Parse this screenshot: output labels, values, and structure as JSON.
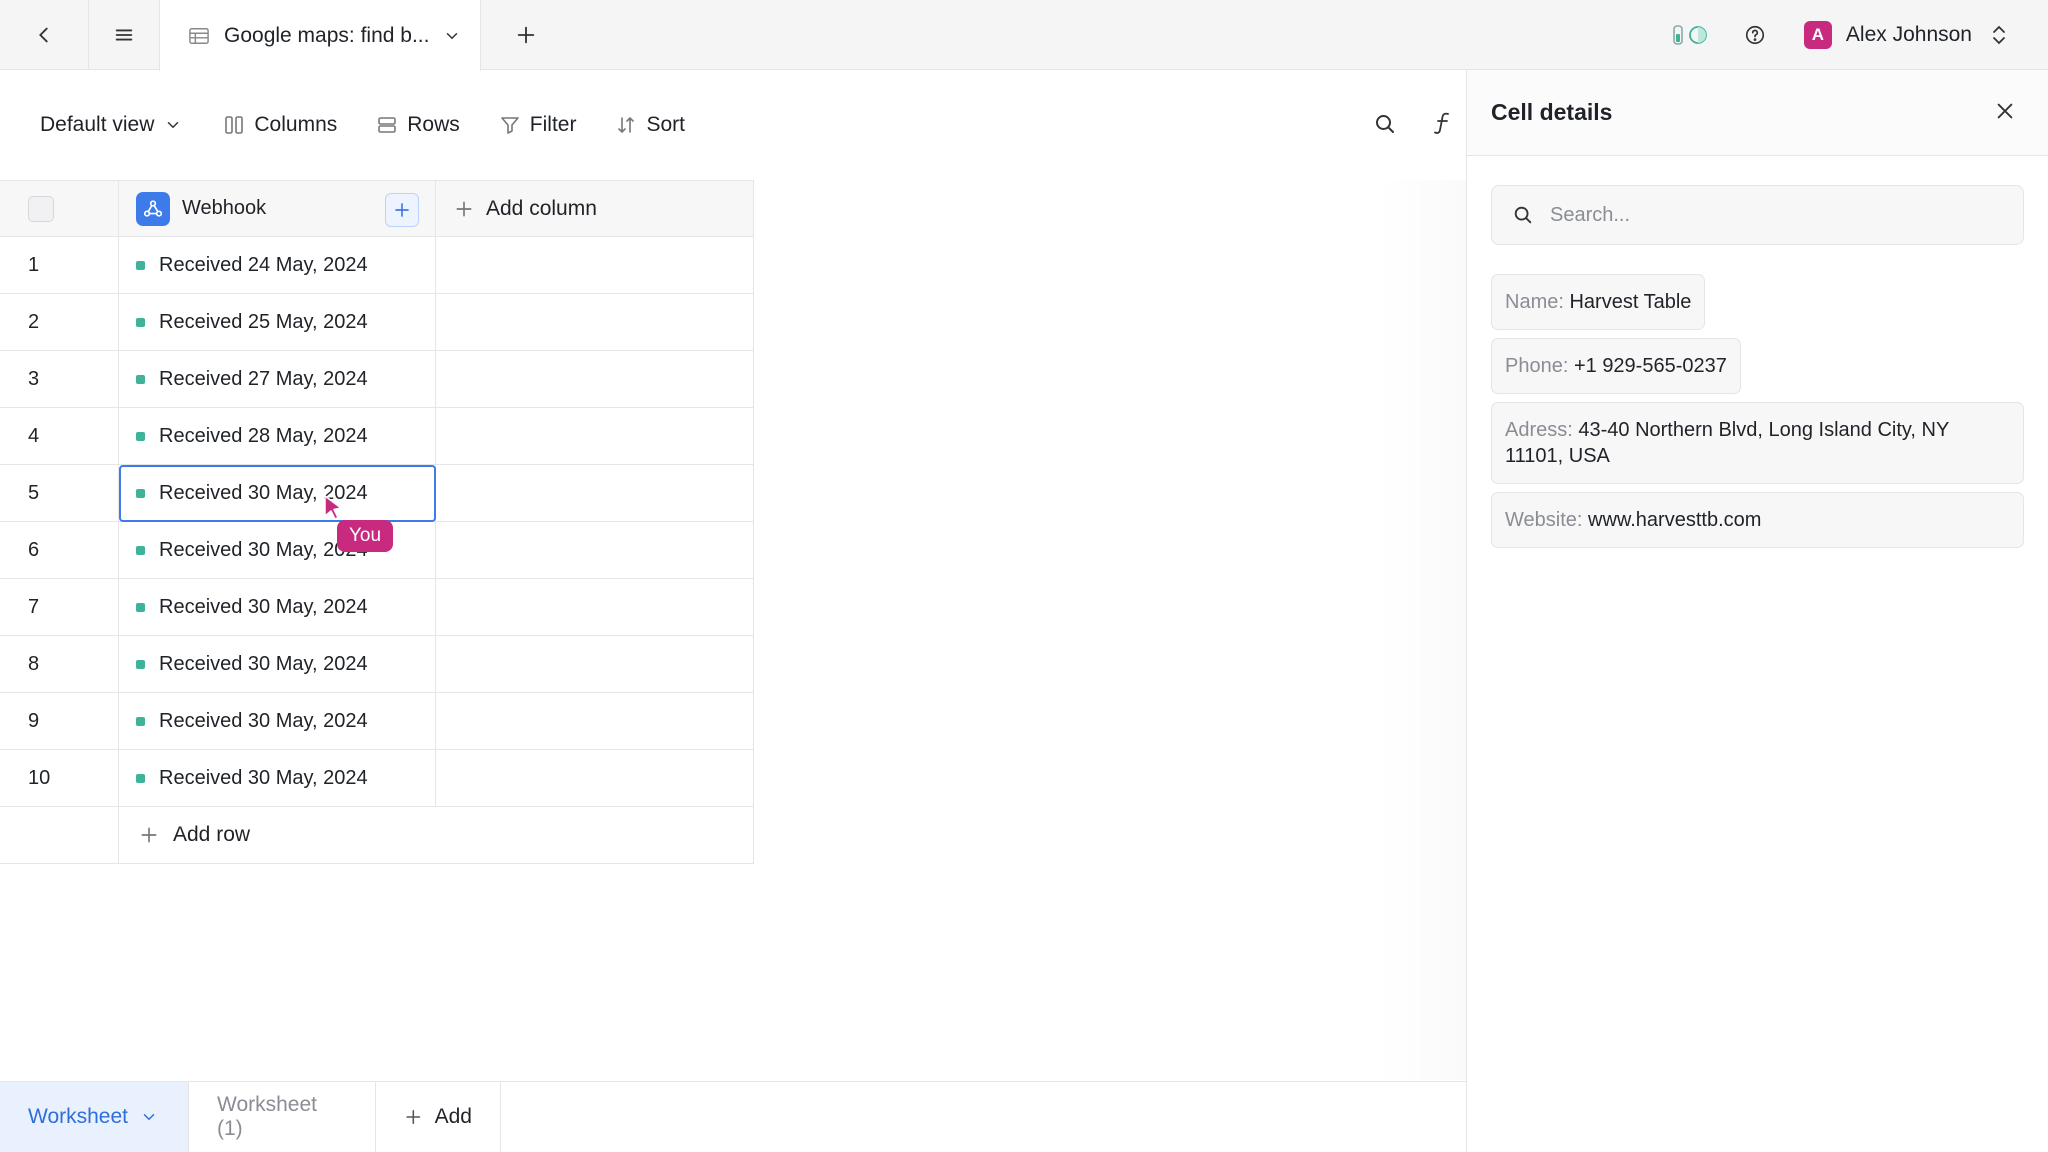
{
  "topbar": {
    "tab_title": "Google maps: find b...",
    "user_name": "Alex Johnson",
    "avatar_letter": "A"
  },
  "toolbar": {
    "view_label": "Default view",
    "columns_label": "Columns",
    "rows_label": "Rows",
    "filter_label": "Filter",
    "sort_label": "Sort"
  },
  "grid": {
    "column_header": "Webhook",
    "add_column_label": "Add column",
    "add_row_label": "Add row",
    "rows": [
      {
        "num": "1",
        "value": "Received 24 May, 2024"
      },
      {
        "num": "2",
        "value": "Received 25 May, 2024"
      },
      {
        "num": "3",
        "value": "Received 27 May, 2024"
      },
      {
        "num": "4",
        "value": "Received 28 May, 2024"
      },
      {
        "num": "5",
        "value": "Received 30 May, 2024"
      },
      {
        "num": "6",
        "value": "Received 30 May, 2024"
      },
      {
        "num": "7",
        "value": "Received 30 May, 2024"
      },
      {
        "num": "8",
        "value": "Received 30 May, 2024"
      },
      {
        "num": "9",
        "value": "Received 30 May, 2024"
      },
      {
        "num": "10",
        "value": "Received 30 May, 2024"
      }
    ],
    "cursor_label": "You"
  },
  "bottombar": {
    "tab_active": "Worksheet",
    "tab_inactive": "Worksheet (1)",
    "add_label": "Add"
  },
  "panel": {
    "title": "Cell details",
    "search_placeholder": "Search...",
    "fields": {
      "name_key": "Name:",
      "name_value": "Harvest Table",
      "phone_key": "Phone:",
      "phone_value": "+1 929-565-0237",
      "address_key": "Adress:",
      "address_value": "43-40 Northern Blvd, Long Island City, NY 11101, USA",
      "website_key": "Website:",
      "website_value": "www.harvesttb.com"
    }
  },
  "colors": {
    "accent": "#3c7be9",
    "avatar": "#c72a7e",
    "status_dot": "#3fb39a"
  }
}
